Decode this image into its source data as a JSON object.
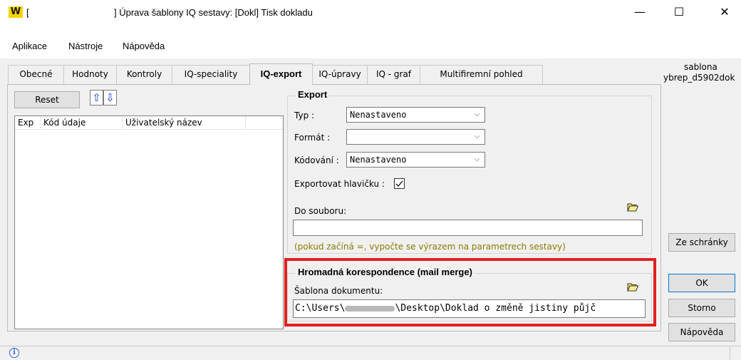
{
  "window": {
    "logo": "W",
    "title_prefix": "[",
    "title": "] Úprava šablony IQ sestavy: [Dokl] Tisk dokladu",
    "minimize": "—",
    "maximize": "☐",
    "close": "✕"
  },
  "menu": [
    "Aplikace",
    "Nástroje",
    "Nápověda"
  ],
  "tabs": [
    {
      "label": "Obecné",
      "active": false
    },
    {
      "label": "Hodnoty",
      "active": false
    },
    {
      "label": "Kontroly",
      "active": false
    },
    {
      "label": "IQ-speciality",
      "active": false
    },
    {
      "label": "IQ-export",
      "active": true
    },
    {
      "label": "IQ-úpravy",
      "active": false
    },
    {
      "label": "IQ - graf",
      "active": false
    },
    {
      "label": "Multifiremní pohled",
      "active": false
    }
  ],
  "left": {
    "reset_label": "Reset",
    "up_icon": "⇧",
    "down_icon": "⇩",
    "columns": [
      "Exp",
      "Kód údaje",
      "Uživatelský název"
    ]
  },
  "export": {
    "title": "Export",
    "typ_label": "Typ :",
    "typ_value": "Nenastaveno",
    "format_label": "Formát :",
    "format_value": "",
    "kodovani_label": "Kódování :",
    "kodovani_value": "Nenastaveno",
    "hlavicka_label": "Exportovat hlavičku :",
    "hlavicka_checked": true,
    "soubor_label": "Do souboru:",
    "soubor_value": "",
    "hint": "(pokud začíná =, vypočte se výrazem na parametrech sestavy)"
  },
  "mailmerge": {
    "title": "Hromadná korespondence (mail merge)",
    "sablona_label": "Šablona dokumentu:",
    "path_prefix": "C:\\Users\\",
    "path_suffix": "\\Desktop\\Doklad o změně jistiny půjč"
  },
  "side": {
    "sablona_label": "sablona",
    "sablona_value": "ybrep_d5902dok",
    "clipboard_label": "Ze schránky",
    "ok_label": "OK",
    "storno_label": "Storno",
    "help_label": "Nápověda"
  },
  "status": {
    "info_icon": "i"
  },
  "colors": {
    "highlight_red": "#e02020",
    "hint_text": "#8a7a00",
    "logo_yellow": "#f5d400"
  }
}
